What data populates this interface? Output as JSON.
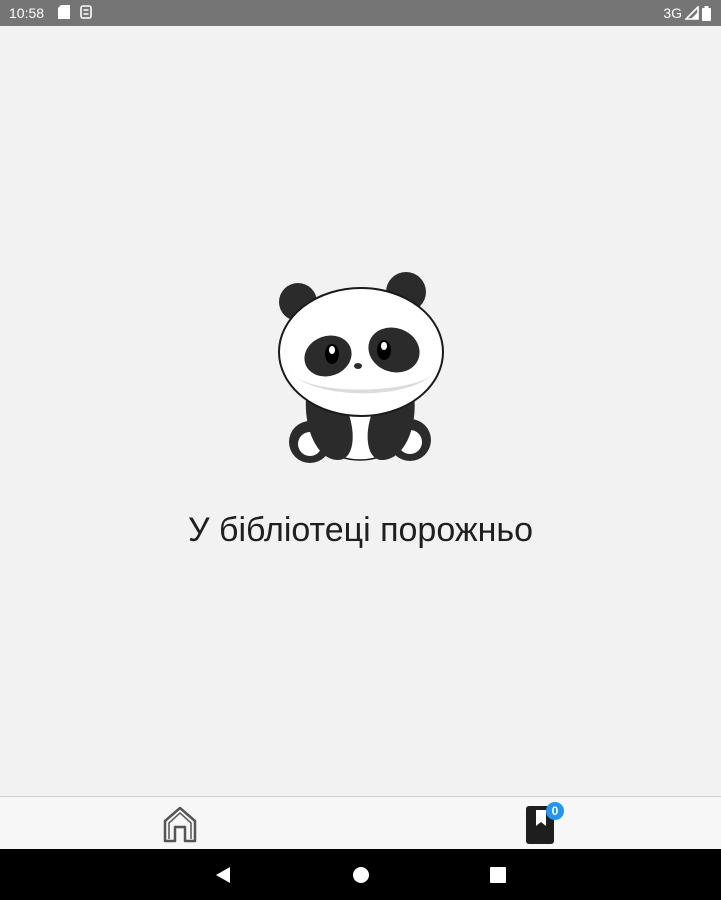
{
  "status_bar": {
    "time": "10:58",
    "network": "3G",
    "left_icons": [
      "sd-card-icon",
      "sync-icon"
    ],
    "right_icons": [
      "signal-icon",
      "battery-icon"
    ]
  },
  "main": {
    "illustration": "panda-illustration",
    "empty_message": "У бібліотеці порожньо"
  },
  "bottom_nav": {
    "items": [
      {
        "icon": "home-icon"
      },
      {
        "icon": "bookmark-book-icon",
        "badge": "0"
      }
    ],
    "badge_color": "#2196f3"
  },
  "system_nav": {
    "buttons": [
      "back-icon",
      "home-circle-icon",
      "recents-icon"
    ]
  }
}
